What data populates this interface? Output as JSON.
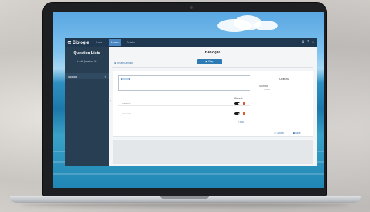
{
  "app": {
    "brand": "Biologie",
    "tabs": [
      {
        "label": "Home",
        "active": false
      },
      {
        "label": "Lesson",
        "active": true
      },
      {
        "label": "Results",
        "active": false
      }
    ],
    "top_icons": [
      "gear-icon",
      "help-icon",
      "user-icon"
    ]
  },
  "sidebar": {
    "title": "Question Lists",
    "add_label": "+ Add Question List",
    "items": [
      {
        "label": "Biologie",
        "chevron": "›"
      }
    ]
  },
  "main": {
    "page_title": "Biologie",
    "create_label": "Create Question",
    "play_label": "Play",
    "question_placeholder": "",
    "correct_label": "Correct",
    "answers": [
      {
        "placeholder": "Answer 1"
      },
      {
        "placeholder": "Answer 2"
      }
    ],
    "add_label": "+ Add",
    "options_title": "Options",
    "scoring_label": "Scoring",
    "scoring_value": "Correct",
    "cancel_label": "✕ Cancel",
    "save_label": "Save"
  },
  "colors": {
    "topbar": "#1f3850",
    "sidebar": "#283e52",
    "accent": "#2e7ab5",
    "delete": "#e0572f"
  }
}
